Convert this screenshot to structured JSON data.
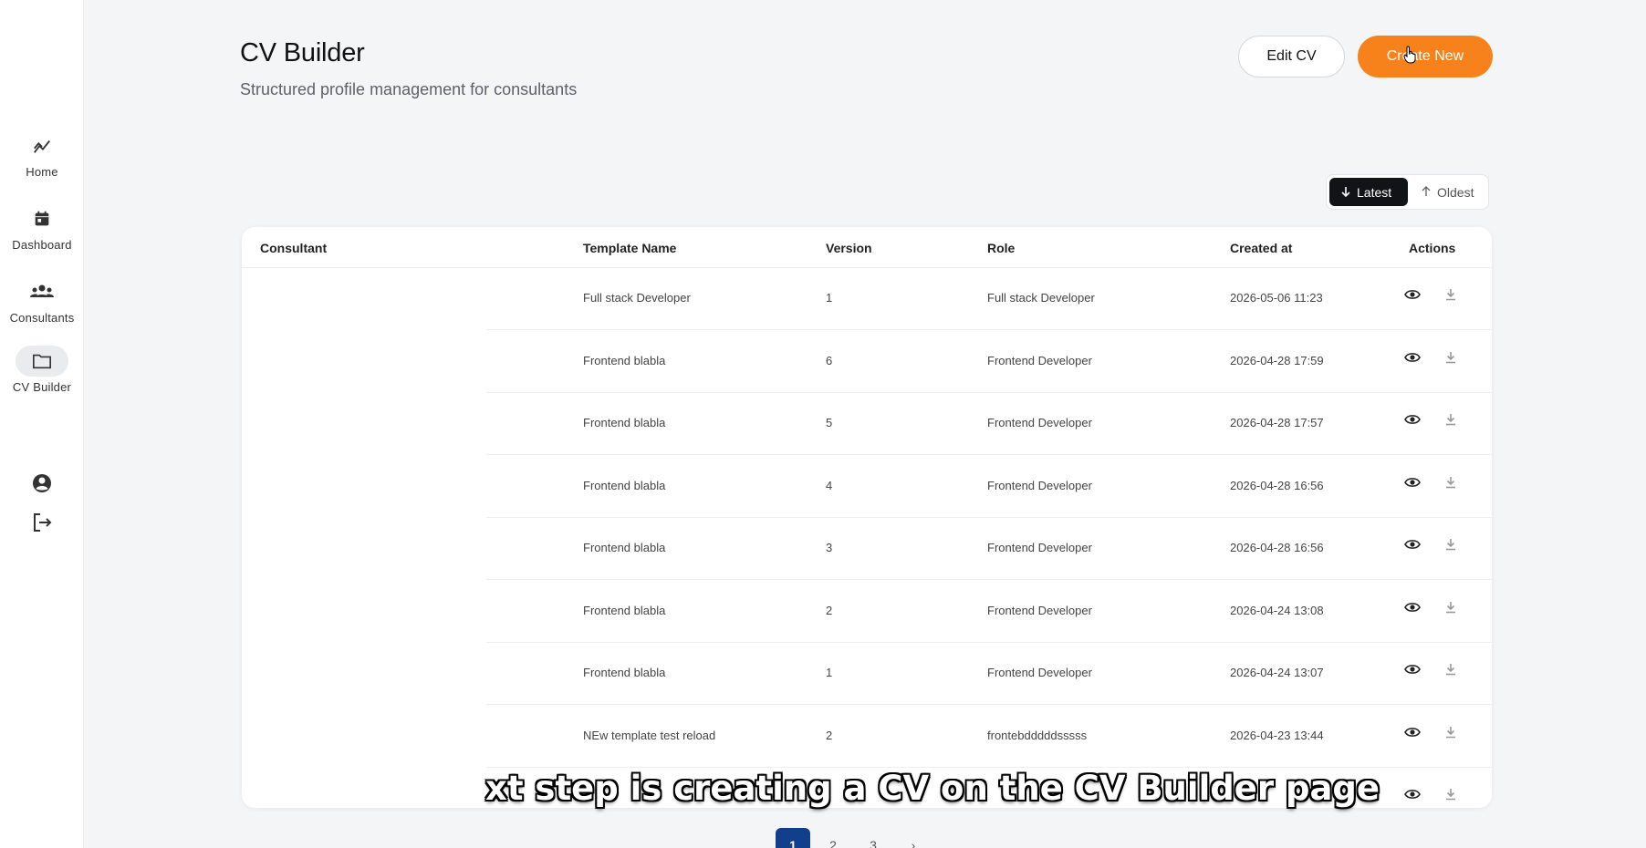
{
  "sidebar": {
    "items": [
      {
        "label": "Home",
        "icon": "chart-line-icon"
      },
      {
        "label": "Dashboard",
        "icon": "calendar-icon"
      },
      {
        "label": "Consultants",
        "icon": "group-icon"
      },
      {
        "label": "CV Builder",
        "icon": "folder-icon",
        "active": true
      }
    ],
    "bottom": [
      {
        "icon": "account-circle-icon"
      },
      {
        "icon": "logout-icon"
      }
    ]
  },
  "header": {
    "title": "CV Builder",
    "subtitle": "Structured profile management for consultants",
    "edit_label": "Edit CV",
    "create_label": "Create New"
  },
  "sort": {
    "latest_label": "Latest",
    "oldest_label": "Oldest",
    "active": "Latest"
  },
  "table": {
    "columns": {
      "consultant": "Consultant",
      "template": "Template Name",
      "version": "Version",
      "role": "Role",
      "created": "Created at",
      "actions": "Actions"
    },
    "rows": [
      {
        "template": "Full stack Developer",
        "version": "1",
        "role": "Full stack Developer",
        "created": "2026-05-06 11:23"
      },
      {
        "template": "Frontend blabla",
        "version": "6",
        "role": "Frontend Developer",
        "created": "2026-04-28 17:59"
      },
      {
        "template": "Frontend blabla",
        "version": "5",
        "role": "Frontend Developer",
        "created": "2026-04-28 17:57"
      },
      {
        "template": "Frontend blabla",
        "version": "4",
        "role": "Frontend Developer",
        "created": "2026-04-28 16:56"
      },
      {
        "template": "Frontend blabla",
        "version": "3",
        "role": "Frontend Developer",
        "created": "2026-04-28 16:56"
      },
      {
        "template": "Frontend blabla",
        "version": "2",
        "role": "Frontend Developer",
        "created": "2026-04-24 13:08"
      },
      {
        "template": "Frontend blabla",
        "version": "1",
        "role": "Frontend Developer",
        "created": "2026-04-24 13:07"
      },
      {
        "template": "NEw template test reload",
        "version": "2",
        "role": "frontebdddddsssss",
        "created": "2026-04-23 13:44"
      },
      {
        "template": "",
        "version": "",
        "role": "",
        "created": ""
      }
    ]
  },
  "pagination": {
    "pages": [
      "1",
      "2",
      "3"
    ],
    "current": "1",
    "next_label": "›"
  },
  "caption": "xt step is creating a CV on the CV Builder page",
  "colors": {
    "accent": "#f7821b",
    "pagination_active": "#123f8c",
    "sort_active": "#121316"
  }
}
